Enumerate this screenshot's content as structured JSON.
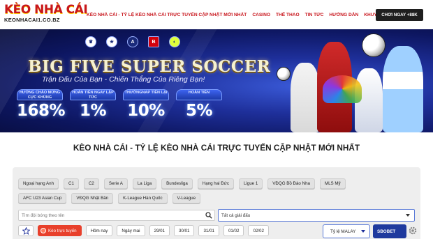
{
  "header": {
    "logo_main": "KÈO NHÀ CÁI",
    "logo_domain": "KEONHACAI1.CO.BZ",
    "nav": [
      {
        "label": "Kèo Nhà Cái - Tỷ Lệ Kèo Nhà Cái Trực Tuyến Cập Nhật Mới Nhất"
      },
      {
        "label": "Casino"
      },
      {
        "label": "Thể Thao"
      },
      {
        "label": "Tin Tức"
      },
      {
        "label": "Hướng Dẫn"
      },
      {
        "label": "Khuyến Mãi"
      }
    ],
    "cta_label": "CHƠI NGAY +88K"
  },
  "banner": {
    "league_logos": [
      "premier-league",
      "uefa-champions-league",
      "serie-a",
      "bundesliga",
      "ligue-1"
    ],
    "title": "BIG FIVE SUPER SOCCER",
    "subtitle": "Trận Đấu Của Bạn - Chiến Thắng Của Riêng Bạn!",
    "promos": [
      {
        "label": "HƯỚNG CHÀO MỪNG CỰC KHỦNG",
        "value": "168%"
      },
      {
        "label": "HOÀN TIỀN NGAY LẬP TỨC",
        "value": "1%"
      },
      {
        "label": "THƯỞNGNAP TIỀN LẠI",
        "value": "10%"
      },
      {
        "label": "HOÀN TIỀN",
        "value": "5%"
      }
    ]
  },
  "page_title": "Kèo Nhà Cái - Tỷ Lệ Kèo Nhà Cái Trực Tuyến Cập Nhật Mới Nhất",
  "filters": {
    "leagues": [
      "Ngoại hạng Anh",
      "C1",
      "C2",
      "Serie A",
      "La Liga",
      "Bundesliga",
      "Hạng hai Đức",
      "Ligue 1",
      "VĐQG Bồ Đào Nha",
      "MLS Mỹ",
      "AFC U23 Asian Cup",
      "VĐQG Nhật Bản",
      "K-League Hàn Quốc",
      "V-League"
    ],
    "search_placeholder": "Tìm đội bóng theo tên",
    "league_select_value": "Tất cả giải đấu",
    "live_label": "Kèo trực tuyến",
    "dates": [
      "Hôm nay",
      "Ngày mai",
      "29/01",
      "30/01",
      "31/01",
      "01/02",
      "02/02"
    ],
    "odds_select_value": "Tỷ lệ MALAY",
    "bookie_select_value": "SBOBET"
  },
  "colors": {
    "brand_red": "#c8161d",
    "cta_bg": "#1f1f1f",
    "live_red": "#e8402b",
    "select_blue": "#1f3a9e",
    "banner_navy": "#0d1660"
  }
}
